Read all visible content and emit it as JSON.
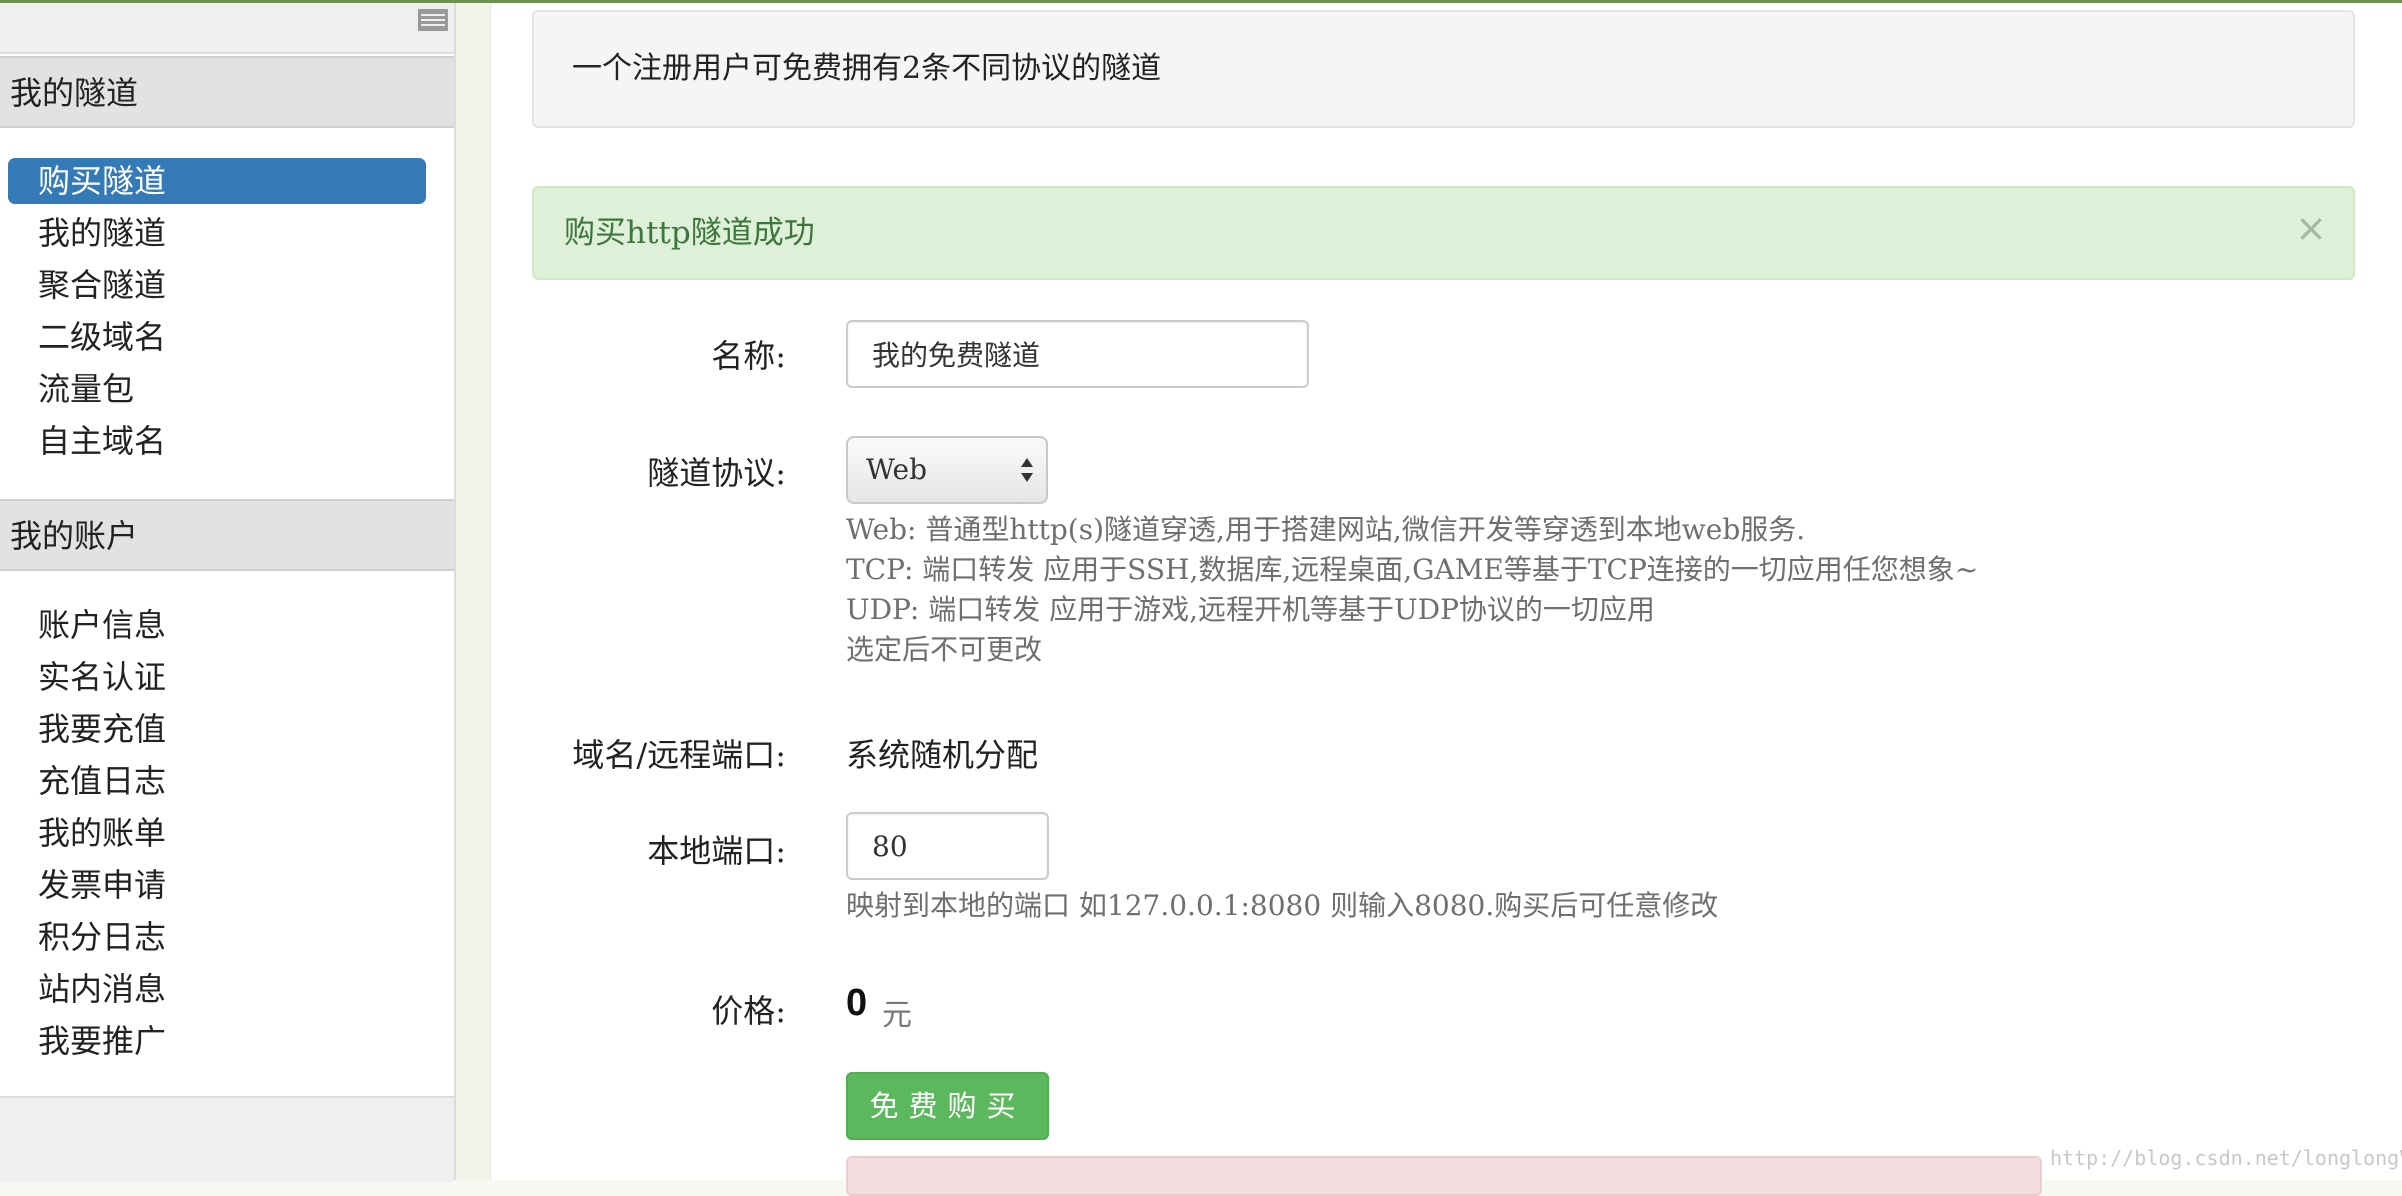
{
  "sidebar": {
    "section1_title": "我的隧道",
    "section1_items": [
      {
        "label": "购买隧道"
      },
      {
        "label": "我的隧道"
      },
      {
        "label": "聚合隧道"
      },
      {
        "label": "二级域名"
      },
      {
        "label": "流量包"
      },
      {
        "label": "自主域名"
      }
    ],
    "active_item": "购买隧道",
    "section2_title": "我的账户",
    "section2_items": [
      {
        "label": "账户信息"
      },
      {
        "label": "实名认证"
      },
      {
        "label": "我要充值"
      },
      {
        "label": "充值日志"
      },
      {
        "label": "我的账单"
      },
      {
        "label": "发票申请"
      },
      {
        "label": "积分日志"
      },
      {
        "label": "站内消息"
      },
      {
        "label": "我要推广"
      }
    ]
  },
  "main": {
    "info_text": "一个注册用户可免费拥有2条不同协议的隧道",
    "success_alert": "购买http隧道成功",
    "alert_close": "×",
    "form": {
      "name_label": "名称:",
      "name_value": "我的免费隧道",
      "protocol_label": "隧道协议:",
      "protocol_value": "Web",
      "protocol_help": [
        "Web: 普通型http(s)隧道穿透,用于搭建网站,微信开发等穿透到本地web服务.",
        "TCP: 端口转发 应用于SSH,数据库,远程桌面,GAME等基于TCP连接的一切应用任您想象~",
        "UDP: 端口转发 应用于游戏,远程开机等基于UDP协议的一切应用",
        "选定后不可更改"
      ],
      "domain_label": "域名/远程端口:",
      "domain_value": "系统随机分配",
      "local_port_label": "本地端口:",
      "local_port_value": "80",
      "local_port_help": "映射到本地的端口 如127.0.0.1:8080 则输入8080.购买后可任意修改",
      "price_label": "价格:",
      "price_value": "0",
      "price_unit": "元",
      "buy_button": "免费购买"
    }
  },
  "watermark": "http://blog.csdn.net/longlongValue",
  "colors": {
    "active_bg": "#337ab7",
    "success_bg": "#dff0d8",
    "success_text": "#3c763d",
    "button_green": "#5cb85c"
  }
}
